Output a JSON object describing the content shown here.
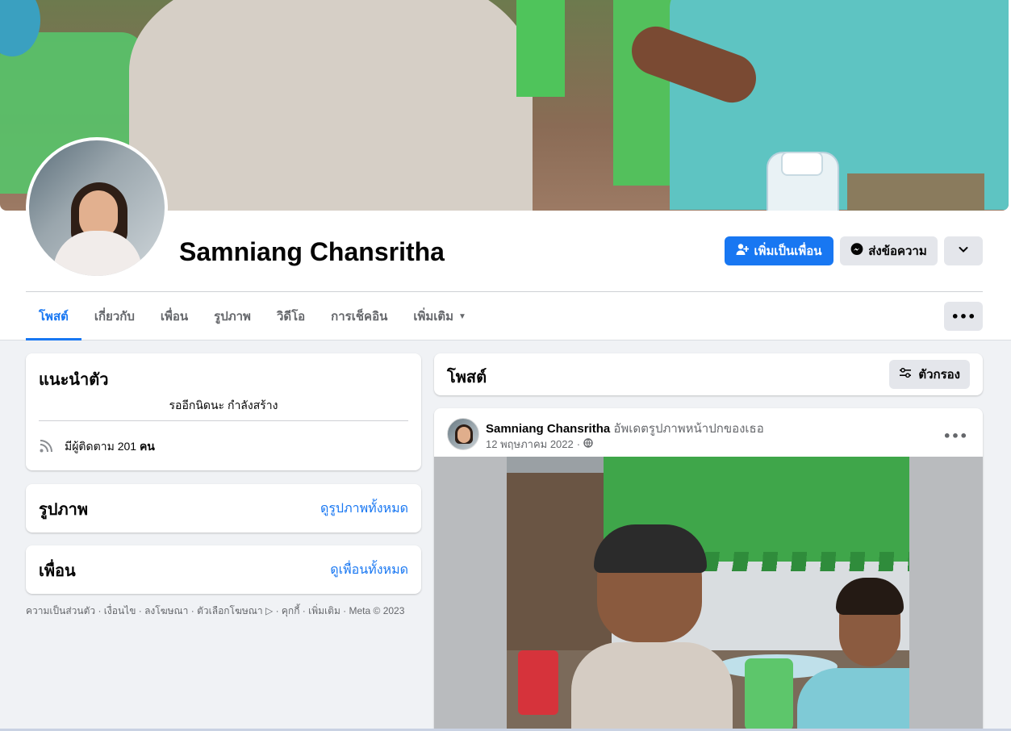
{
  "profile": {
    "name": "Samniang Chansritha",
    "cover_alt": "cover photo",
    "avatar_alt": "profile picture"
  },
  "actions": {
    "add_friend_label": "เพิ่มเป็นเพื่อน",
    "message_label": "ส่งข้อความ",
    "dropdown_icon": "chevron-down-icon"
  },
  "tabs": [
    {
      "label": "โพสต์",
      "active": true
    },
    {
      "label": "เกี่ยวกับ",
      "active": false
    },
    {
      "label": "เพื่อน",
      "active": false
    },
    {
      "label": "รูปภาพ",
      "active": false
    },
    {
      "label": "วิดีโอ",
      "active": false
    },
    {
      "label": "การเช็คอิน",
      "active": false
    },
    {
      "label": "เพิ่มเติม",
      "active": false
    }
  ],
  "more_button": "•••",
  "intro": {
    "title": "แนะนำตัว",
    "bio": "รออีกนิดนะ กำลังสร้าง",
    "followers_prefix": "มีผู้ติดตาม",
    "followers_count": "201",
    "followers_suffix": "คน"
  },
  "photos_card": {
    "title": "รูปภาพ",
    "see_all": "ดูรูปภาพทั้งหมด"
  },
  "friends_card": {
    "title": "เพื่อน",
    "see_all": "ดูเพื่อนทั้งหมด"
  },
  "footer": {
    "text": "ความเป็นส่วนตัว · เงื่อนไข · ลงโฆษณา · ตัวเลือกโฆษณา ▷ · คุกกี้ · เพิ่มเติม · Meta © 2023"
  },
  "posts": {
    "title": "โพสต์",
    "filter_label": "ตัวกรอง"
  },
  "post": {
    "author": "Samniang Chansritha",
    "action": "อัพเดตรูปภาพหน้าปกของเธอ",
    "date": "12 พฤษภาคม 2022",
    "separator": "·",
    "more": "•••"
  },
  "colors": {
    "accent": "#1877f2",
    "background": "#f0f2f5",
    "secondary_button": "#e4e6eb",
    "muted_text": "#65676b"
  }
}
